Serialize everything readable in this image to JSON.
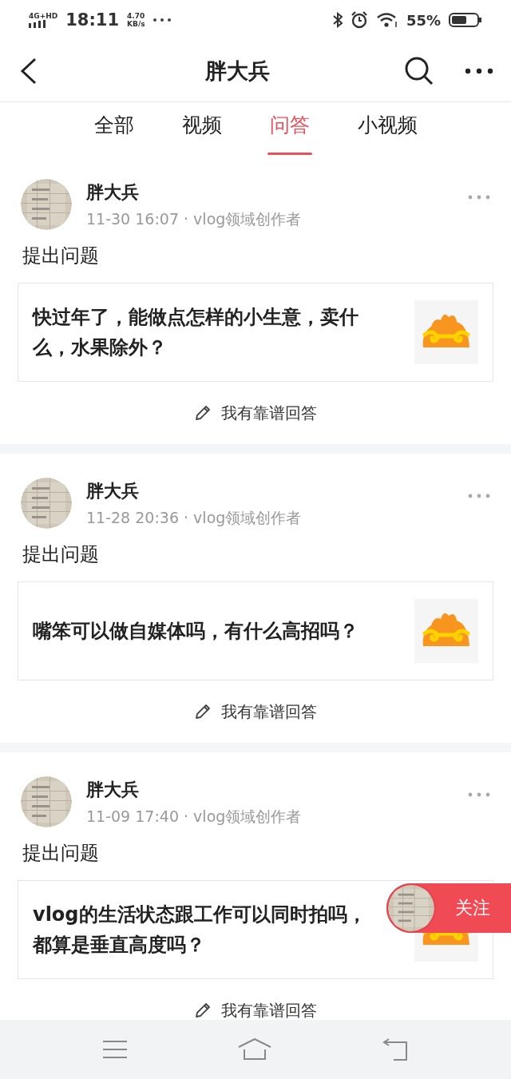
{
  "status_bar": {
    "network": "4G+HD",
    "time": "18:11",
    "speed_value": "4.70",
    "speed_unit": "KB/s",
    "battery": "55%"
  },
  "header": {
    "title": "胖大兵"
  },
  "tabs": [
    {
      "label": "全部",
      "selected": false
    },
    {
      "label": "视频",
      "selected": false
    },
    {
      "label": "问答",
      "selected": true
    },
    {
      "label": "小视频",
      "selected": false
    }
  ],
  "posts": [
    {
      "author": "胖大兵",
      "meta": "11-30 16:07 · vlog领域创作者",
      "action": "提出问题",
      "question": "快过年了，能做点怎样的小生意，卖什么，水果除外？",
      "answer_label": "我有靠谱回答"
    },
    {
      "author": "胖大兵",
      "meta": "11-28 20:36 · vlog领域创作者",
      "action": "提出问题",
      "question": "嘴笨可以做自媒体吗，有什么高招吗？",
      "answer_label": "我有靠谱回答"
    },
    {
      "author": "胖大兵",
      "meta": "11-09 17:40 · vlog领域创作者",
      "action": "提出问题",
      "question": "vlog的生活状态跟工作可以同时拍吗，都算是垂直高度吗？",
      "answer_label": "我有靠谱回答"
    }
  ],
  "follow_button": {
    "label": "关注"
  }
}
